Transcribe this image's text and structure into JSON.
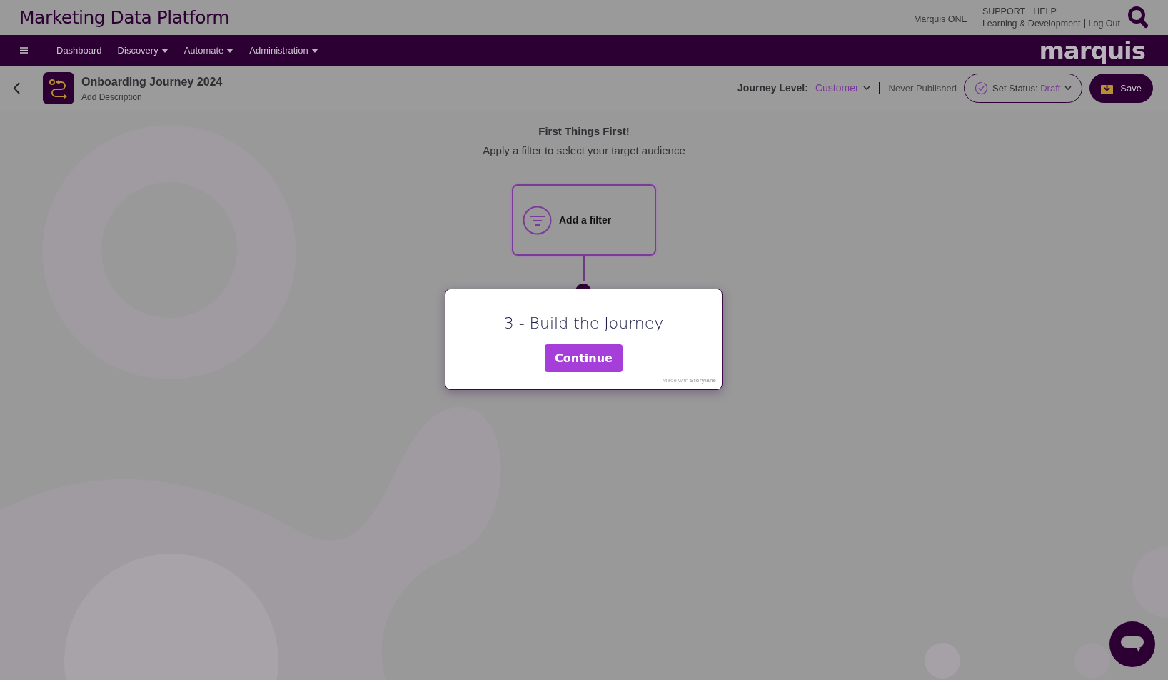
{
  "header": {
    "title": "Marketing Data Platform",
    "account": "Marquis ONE",
    "links_top": [
      "SUPPORT",
      "HELP"
    ],
    "links_bottom": [
      "Learning & Development",
      "Log Out"
    ]
  },
  "nav": {
    "items": [
      {
        "label": "Dashboard",
        "dropdown": false
      },
      {
        "label": "Discovery",
        "dropdown": true
      },
      {
        "label": "Automate",
        "dropdown": true
      },
      {
        "label": "Administration",
        "dropdown": true
      }
    ],
    "logo": "marquis"
  },
  "journey": {
    "title": "Onboarding Journey 2024",
    "description": "Add Description",
    "level_label": "Journey Level:",
    "level_value": "Customer",
    "publish_state": "Never Published",
    "status_label": "Set Status:",
    "status_value": "Draft",
    "save": "Save"
  },
  "canvas": {
    "heading": "First Things First!",
    "subheading": "Apply a filter to select your target audience",
    "node": "Add a filter"
  },
  "popup": {
    "title": "3 - Build the Journey",
    "button": "Continue",
    "credit": "Made with",
    "credit_brand": "Storylane"
  }
}
